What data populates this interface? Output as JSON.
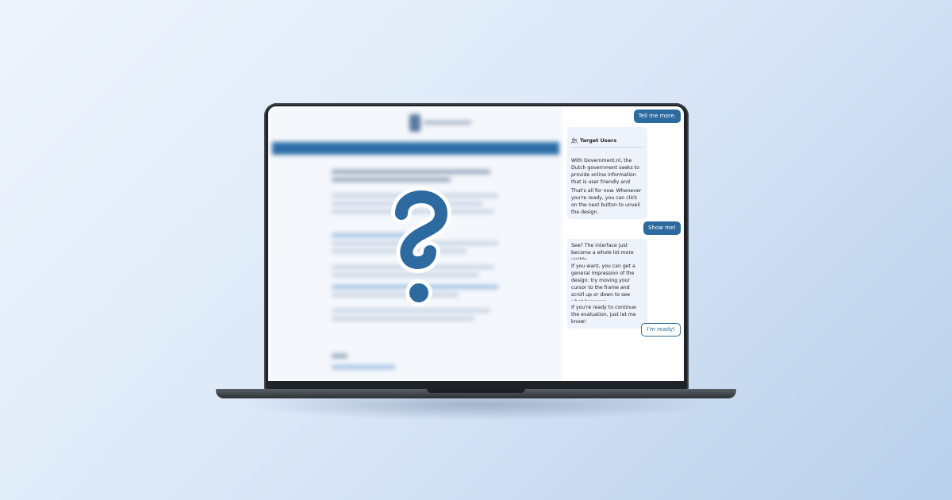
{
  "chat": {
    "messages": [
      {
        "role": "user",
        "text": "Tell me more."
      },
      {
        "role": "bot",
        "title": "Target Users",
        "title_icon": "users-icon",
        "text": "With Government.nl, the Dutch government seeks to provide online information that is user friendly and accessible to all types of visitors."
      },
      {
        "role": "bot",
        "text": "That's all for now. Whenever you're ready, you can click on the next button to unveil the design."
      },
      {
        "role": "user",
        "text": "Show me!"
      },
      {
        "role": "bot",
        "text": "See? The interface just become a whole lot more visible."
      },
      {
        "role": "bot",
        "text": "If you want, you can get a general impression of the design: try moving your cursor to the frame and scroll up or down to see what happens."
      },
      {
        "role": "bot",
        "text": "If you're ready to continue the evaluation, just let me know!"
      }
    ],
    "ready_button": "I'm ready!"
  },
  "colors": {
    "accent": "#2d6aa0",
    "bot_bubble": "#eef2fb",
    "question_mark": "#2d6aa0"
  },
  "overlay_icon": "question-mark-icon"
}
